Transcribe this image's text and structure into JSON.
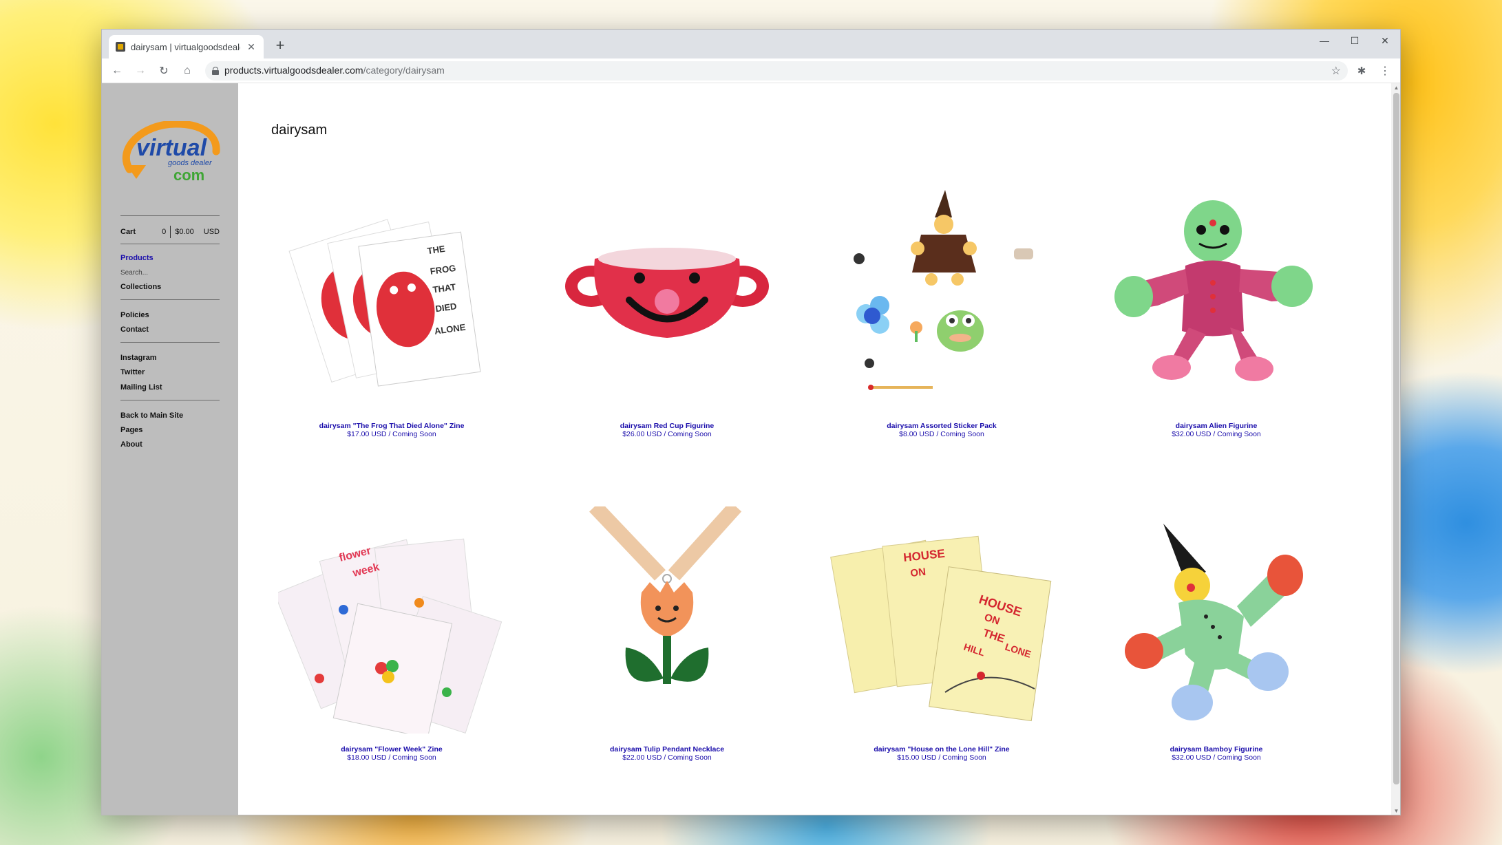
{
  "browser": {
    "tab_title": "dairysam | virtualgoodsdealer",
    "url_host": "products.virtualgoodsdealer.com",
    "url_path": "/category/dairysam"
  },
  "sidebar": {
    "logo_text_main": "virtual",
    "logo_text_sub": "goods dealer",
    "logo_text_com": "com",
    "cart": {
      "label": "Cart",
      "count": "0",
      "total": "$0.00",
      "currency": "USD"
    },
    "nav_primary": [
      "Products",
      "Collections"
    ],
    "search_placeholder": "Search...",
    "nav_info": [
      "Policies",
      "Contact"
    ],
    "nav_social": [
      "Instagram",
      "Twitter",
      "Mailing List"
    ],
    "nav_site": [
      "Back to Main Site",
      "Pages",
      "About"
    ]
  },
  "page": {
    "title": "dairysam"
  },
  "products": [
    {
      "name": "dairysam \"The Frog That Died Alone\" Zine",
      "price": "$17.00 USD / Coming Soon"
    },
    {
      "name": "dairysam Red Cup Figurine",
      "price": "$26.00 USD / Coming Soon"
    },
    {
      "name": "dairysam Assorted Sticker Pack",
      "price": "$8.00 USD / Coming Soon"
    },
    {
      "name": "dairysam Alien Figurine",
      "price": "$32.00 USD / Coming Soon"
    },
    {
      "name": "dairysam \"Flower Week\" Zine",
      "price": "$18.00 USD / Coming Soon"
    },
    {
      "name": "dairysam Tulip Pendant Necklace",
      "price": "$22.00 USD / Coming Soon"
    },
    {
      "name": "dairysam \"House on the Lone Hill\" Zine",
      "price": "$15.00 USD / Coming Soon"
    },
    {
      "name": "dairysam Bamboy Figurine",
      "price": "$32.00 USD / Coming Soon"
    }
  ],
  "zine_text": {
    "frog": [
      "THE",
      "FROG",
      "THAT",
      "DIED",
      "ALONE"
    ],
    "house": [
      "HOUSE",
      "ON",
      "THE",
      "LONE",
      "HILL"
    ],
    "flower": [
      "flower",
      "week"
    ]
  },
  "colors": {
    "link": "#1a0dab",
    "sidebar_bg": "#bdbdbd",
    "logo_orange": "#f39a1c",
    "logo_blue": "#1f4aa8",
    "logo_green": "#3fa535"
  }
}
